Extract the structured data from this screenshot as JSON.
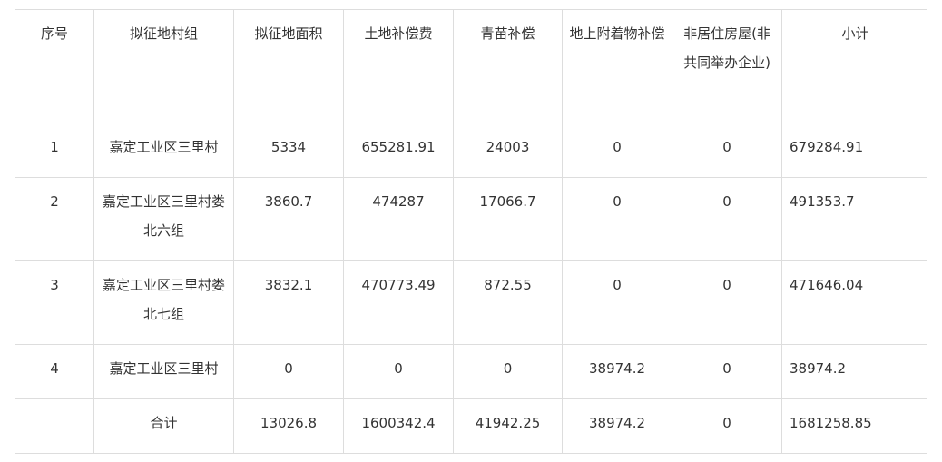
{
  "headers": [
    "序号",
    "拟征地村组",
    "拟征地面积",
    "土地补偿费",
    "青苗补偿",
    "地上附着物补偿",
    "非居住房屋(非共同举办企业)",
    "小计"
  ],
  "rows": [
    [
      "1",
      "嘉定工业区三里村",
      "5334",
      "655281.91",
      "24003",
      "0",
      "0",
      "679284.91"
    ],
    [
      "2",
      "嘉定工业区三里村娄北六组",
      "3860.7",
      "474287",
      "17066.7",
      "0",
      "0",
      "491353.7"
    ],
    [
      "3",
      "嘉定工业区三里村娄北七组",
      "3832.1",
      "470773.49",
      "872.55",
      "0",
      "0",
      "471646.04"
    ],
    [
      "4",
      "嘉定工业区三里村",
      "0",
      "0",
      "0",
      "38974.2",
      "0",
      "38974.2"
    ],
    [
      "",
      "合计",
      "13026.8",
      "1600342.4",
      "41942.25",
      "38974.2",
      "0",
      "1681258.85"
    ]
  ]
}
